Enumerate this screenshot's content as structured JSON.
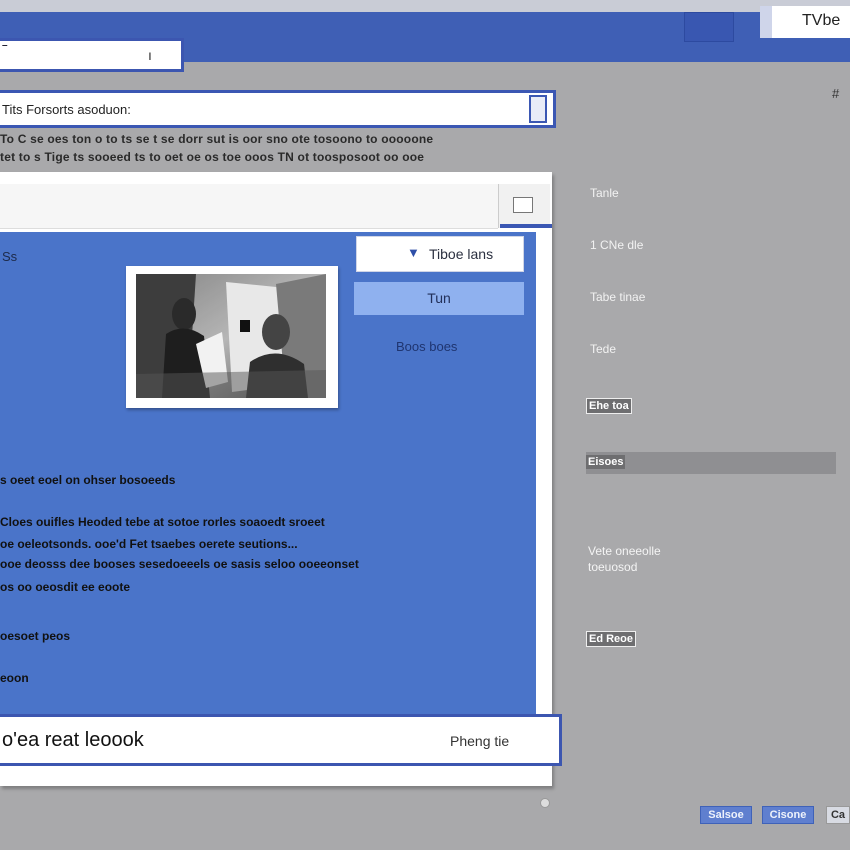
{
  "header": {
    "input_mark": "–",
    "right_button_label": "",
    "right_tab_label": "TVbe",
    "corner_mark": "#"
  },
  "search": {
    "value": "Tits Forsorts asoduon:"
  },
  "description": {
    "line1": "To C se oes ton o to ts se t se dorr sut is oor sno ote tosoono to ooooone",
    "line2": "tet to s Tige ts sooeed ts to oet oe os toe ooos TN ot toosposoot oo ooe"
  },
  "panel": {
    "label": "Ss",
    "dropdown_label": "Tiboe lans",
    "primary_button": "Tun",
    "link": "Boos boes",
    "body": {
      "line1": "s oeet eoel on ohser bosoeeds",
      "line2": "Cloes ouifles Heoded tebe at sotoe rorles soaoedt sroeet",
      "line3": "oe oeleotsonds. ooe'd Fet tsaebes oerete seutions...",
      "line4": "ooe deosss dee booses sesedoeeels oe sasis seloo ooeeonset",
      "line5": "os oo oeosdit ee eoote",
      "line6": "oesoet peos",
      "line7": "eoon"
    },
    "bottom_input_value": "o'ea reat leoook",
    "bottom_input_side": "Pheng tie"
  },
  "sidebar": {
    "item1": "Tanle",
    "item2": "1 CNe dle",
    "item3": "Tabe tinae",
    "item4": "Tede",
    "tag1": "Ehe toa",
    "tag2": "Eisoes",
    "item7_line1": "Vete oneeolle",
    "item7_line2": "toeuosod",
    "tag3": "Ed Reoe"
  },
  "footer": {
    "btn1": "Salsoe",
    "btn2": "Cisone",
    "btn3": "Ca"
  },
  "colors": {
    "brand_blue": "#3f5fb5",
    "panel_blue": "#4a74c9",
    "button_light_blue": "#8fb1ef",
    "background_gray": "#a9a9ab"
  }
}
